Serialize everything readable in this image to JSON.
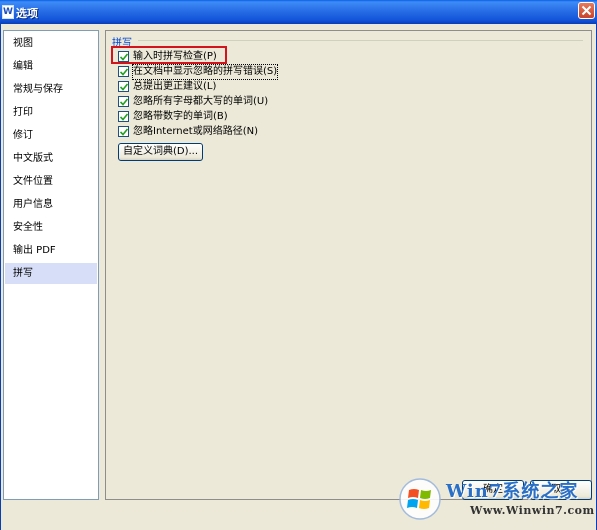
{
  "window": {
    "title": "选项",
    "title_icon": "W",
    "close_icon": "close-icon"
  },
  "sidebar": {
    "items": [
      {
        "label": "视图"
      },
      {
        "label": "编辑"
      },
      {
        "label": "常规与保存"
      },
      {
        "label": "打印"
      },
      {
        "label": "修订"
      },
      {
        "label": "中文版式"
      },
      {
        "label": "文件位置"
      },
      {
        "label": "用户信息"
      },
      {
        "label": "安全性"
      },
      {
        "label": "输出 PDF"
      },
      {
        "label": "拼写"
      }
    ],
    "selected": "拼写"
  },
  "spelling": {
    "group_title": "拼写",
    "options": [
      {
        "label": "输入时拼写检查(P)",
        "checked": true,
        "highlighted": true
      },
      {
        "label": "在文档中显示忽略的拼写错误(S)",
        "checked": true,
        "focused": true
      },
      {
        "label": "总提出更正建议(L)",
        "checked": true
      },
      {
        "label": "忽略所有字母都大写的单词(U)",
        "checked": true
      },
      {
        "label": "忽略带数字的单词(B)",
        "checked": true
      },
      {
        "label": "忽略Internet或网络路径(N)",
        "checked": true
      }
    ],
    "dictionary_button": "自定义词典(D)..."
  },
  "footer": {
    "ok_label": "确定",
    "cancel_label": "取消"
  },
  "watermark": {
    "title": "Win7系统之家",
    "url": "Www.Winwin7.com"
  },
  "colors": {
    "titlebar": "#0a5fe4",
    "highlight_box": "#d3141c",
    "selected_item_bg": "#d6dff7",
    "group_title": "#0046d5"
  }
}
